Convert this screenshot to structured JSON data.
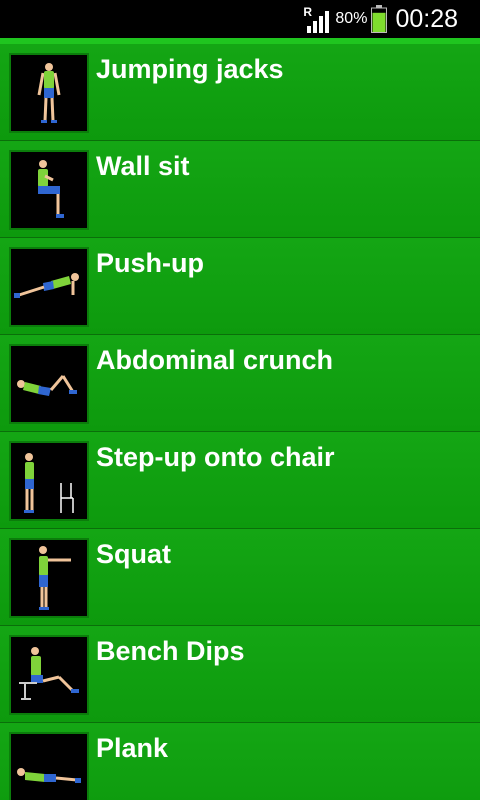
{
  "status_bar": {
    "roaming": "R",
    "battery_percent": "80%",
    "time": "00:28",
    "battery_level": 0.8,
    "icons": [
      "signal-icon",
      "battery-icon"
    ]
  },
  "colors": {
    "accent_green": "#14a614",
    "row_border": "#0a6f0a",
    "battery_green": "#7fdc2e"
  },
  "exercises": [
    {
      "label": "Jumping jacks",
      "icon": "jumping-jacks-figure-icon"
    },
    {
      "label": "Wall sit",
      "icon": "wall-sit-figure-icon"
    },
    {
      "label": "Push-up",
      "icon": "push-up-figure-icon"
    },
    {
      "label": "Abdominal crunch",
      "icon": "abdominal-crunch-figure-icon"
    },
    {
      "label": "Step-up onto chair",
      "icon": "step-up-figure-icon"
    },
    {
      "label": "Squat",
      "icon": "squat-figure-icon"
    },
    {
      "label": "Bench Dips",
      "icon": "bench-dips-figure-icon"
    },
    {
      "label": "Plank",
      "icon": "plank-figure-icon"
    }
  ]
}
